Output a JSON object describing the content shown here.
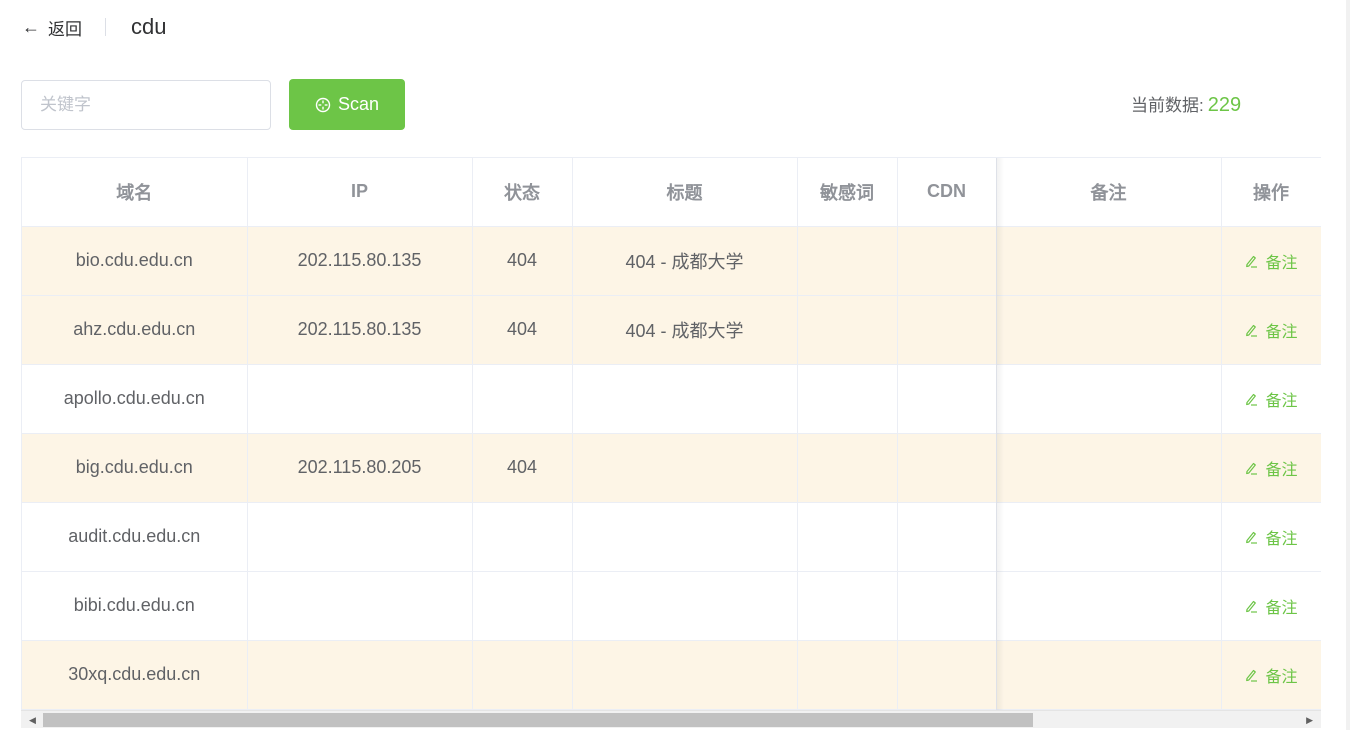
{
  "header": {
    "back_label": "返回",
    "title": "cdu"
  },
  "search": {
    "placeholder": "关键字",
    "value": ""
  },
  "scan_button": {
    "label": "Scan"
  },
  "data_count": {
    "label": "当前数据:",
    "value": "229"
  },
  "table": {
    "columns": [
      "域名",
      "IP",
      "状态",
      "标题",
      "敏感词",
      "CDN",
      "备注",
      "操作"
    ],
    "action_label": "备注",
    "rows": [
      {
        "domain": "bio.cdu.edu.cn",
        "ip": "202.115.80.135",
        "status": "404",
        "title": "404 - 成都大学",
        "sensitive": "",
        "cdn": "",
        "note": "",
        "highlight": true
      },
      {
        "domain": "ahz.cdu.edu.cn",
        "ip": "202.115.80.135",
        "status": "404",
        "title": "404 - 成都大学",
        "sensitive": "",
        "cdn": "",
        "note": "",
        "highlight": true
      },
      {
        "domain": "apollo.cdu.edu.cn",
        "ip": "",
        "status": "",
        "title": "",
        "sensitive": "",
        "cdn": "",
        "note": "",
        "highlight": false
      },
      {
        "domain": "big.cdu.edu.cn",
        "ip": "202.115.80.205",
        "status": "404",
        "title": "",
        "sensitive": "",
        "cdn": "",
        "note": "",
        "highlight": true
      },
      {
        "domain": "audit.cdu.edu.cn",
        "ip": "",
        "status": "",
        "title": "",
        "sensitive": "",
        "cdn": "",
        "note": "",
        "highlight": false
      },
      {
        "domain": "bibi.cdu.edu.cn",
        "ip": "",
        "status": "",
        "title": "",
        "sensitive": "",
        "cdn": "",
        "note": "",
        "highlight": false
      },
      {
        "domain": "30xq.cdu.edu.cn",
        "ip": "",
        "status": "",
        "title": "",
        "sensitive": "",
        "cdn": "",
        "note": "",
        "highlight": true
      }
    ]
  },
  "colors": {
    "accent": "#6dc547",
    "highlight_row": "#fdf5e6",
    "border": "#ebeef5"
  }
}
